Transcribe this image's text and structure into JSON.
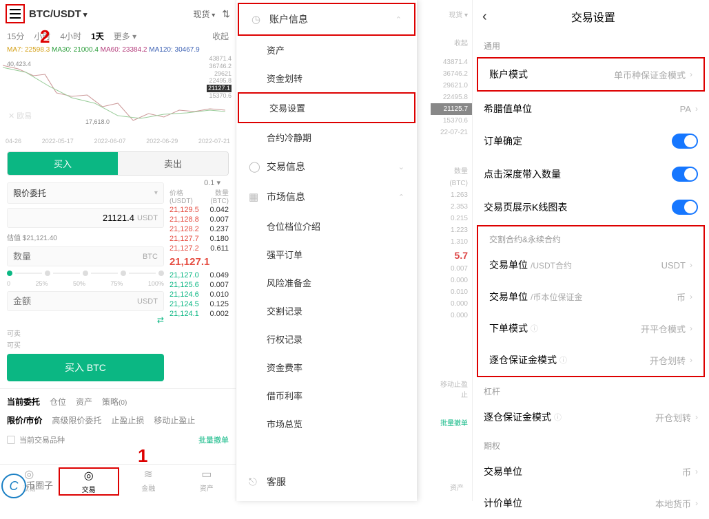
{
  "panel1": {
    "pair": "BTC/USDT",
    "spot_label": "现货",
    "timeframes": [
      "15分",
      "小时",
      "4小时",
      "1天",
      "更多"
    ],
    "tf_active": "1天",
    "collapse": "收起",
    "ma": {
      "ma7": "MA7: 22598.3",
      "ma30": "MA30: 21000.4",
      "ma60": "MA60: 23384.2",
      "ma120": "MA120: 30467.9"
    },
    "chart_data": {
      "type": "line",
      "title": "",
      "xlabel": "",
      "ylabel": "",
      "ylim": [
        15370,
        43871
      ],
      "y_ticks": [
        43871.4,
        36746.2,
        29621.0,
        22495.8,
        21127.1,
        15370.6
      ],
      "x": [
        "04-26",
        "2022-05-17",
        "2022-06-07",
        "2022-06-29",
        "2022-07-21"
      ],
      "annotations": [
        {
          "text": "40,423.4",
          "pos": "top-left"
        },
        {
          "text": "17,618.0",
          "pos": "low"
        }
      ],
      "current": 21127.1
    },
    "dates": [
      "04-26",
      "2022-05-17",
      "2022-06-07",
      "2022-06-29",
      "2022-07-21"
    ],
    "watermark": "欧易",
    "buy": "买入",
    "sell": "卖出",
    "leverage": "0.1",
    "order_type": "限价委托",
    "price_value": "21121.4",
    "price_unit": "USDT",
    "est_label": "估值",
    "est_value": "$21,121.40",
    "qty_ph": "数量",
    "qty_unit": "BTC",
    "pct": [
      "0",
      "25%",
      "50%",
      "75%",
      "100%"
    ],
    "amt_ph": "金额",
    "amt_unit": "USDT",
    "avail_sell": "可卖",
    "avail_buy": "可买",
    "buy_btn": "买入 BTC",
    "ob_price_hdr": "价格",
    "ob_price_unit": "(USDT)",
    "ob_amt_hdr": "数量",
    "ob_amt_unit": "(BTC)",
    "asks": [
      [
        "21,129.5",
        "0.042"
      ],
      [
        "21,128.8",
        "0.007"
      ],
      [
        "21,128.2",
        "0.237"
      ],
      [
        "21,127.7",
        "0.180"
      ],
      [
        "21,127.2",
        "0.611"
      ]
    ],
    "mid": "21,127.1",
    "bids": [
      [
        "21,127.0",
        "0.049"
      ],
      [
        "21,125.6",
        "0.007"
      ],
      [
        "21,124.6",
        "0.010"
      ],
      [
        "21,124.5",
        "0.125"
      ],
      [
        "21,124.1",
        "0.002"
      ]
    ],
    "tabs2": [
      {
        "label": "当前委托",
        "count": ""
      },
      {
        "label": "仓位",
        "count": ""
      },
      {
        "label": "资产",
        "count": ""
      },
      {
        "label": "策略",
        "count": "(0)"
      }
    ],
    "tabs3": [
      "限价/市价",
      "高级限价委托",
      "止盈止损",
      "移动止盈止"
    ],
    "chk_label": "当前交易品种",
    "batch": "批量撤单",
    "nav": [
      {
        "label": "欧易",
        "icon": "◎"
      },
      {
        "label": "交易",
        "icon": "◎"
      },
      {
        "label": "金融",
        "icon": "≋"
      },
      {
        "label": "资产",
        "icon": "▭"
      }
    ],
    "red1": "1",
    "red2": "2"
  },
  "panel2": {
    "strip": {
      "spot": "现货 ▾",
      "collapse": "收起",
      "yvals": [
        "43871.4",
        "36746.2",
        "29621.0",
        "22495.8",
        "21125.7",
        "15370.6"
      ],
      "date": "22-07-21",
      "hdr1": "数量",
      "hdr2": "(BTC)",
      "rows": [
        "1.263",
        "2.353",
        "0.215",
        "1.223",
        "1.310"
      ],
      "mid": "5.7",
      "brows": [
        "0.007",
        "0.000",
        "0.010",
        "0.000",
        "0.000"
      ],
      "last1": "移动止盈止",
      "last2": "批量撤单",
      "navlabel": "资产"
    },
    "drawer": {
      "account_info": "账户信息",
      "items1": [
        "资产",
        "资金划转",
        "交易设置",
        "合约冷静期"
      ],
      "trade_info": "交易信息",
      "market_info": "市场信息",
      "items2": [
        "仓位档位介绍",
        "强平订单",
        "风险准备金",
        "交割记录",
        "行权记录",
        "资金费率",
        "借币利率",
        "市场总览"
      ],
      "support": "客服"
    }
  },
  "panel3": {
    "title": "交易设置",
    "sect_general": "通用",
    "rows1": [
      {
        "label": "账户模式",
        "val": "单币种保证金模式",
        "chev": true,
        "hl": true
      },
      {
        "label": "希腊值单位",
        "val": "PA",
        "chev": true
      },
      {
        "label": "订单确定",
        "toggle": true
      },
      {
        "label": "点击深度带入数量",
        "toggle": true
      },
      {
        "label": "交易页展示K线图表",
        "toggle": true
      }
    ],
    "sect_contract": "交割合约&永续合约",
    "rows2": [
      {
        "label": "交易单位",
        "sub": "/USDT合约",
        "val": "USDT",
        "chev": true
      },
      {
        "label": "交易单位",
        "sub": "/币本位保证金",
        "val": "币",
        "chev": true
      },
      {
        "label": "下单模式",
        "info": true,
        "val": "开平仓模式",
        "chev": true
      },
      {
        "label": "逐仓保证金模式",
        "info": true,
        "val": "开仓划转",
        "chev": true
      }
    ],
    "sect_lever": "杠杆",
    "rows3": [
      {
        "label": "逐仓保证金模式",
        "info": true,
        "val": "开仓划转",
        "chev": true
      }
    ],
    "sect_option": "期权",
    "rows4": [
      {
        "label": "交易单位",
        "val": "币",
        "chev": true
      },
      {
        "label": "计价单位",
        "val": "本地货币",
        "chev": true
      }
    ]
  }
}
